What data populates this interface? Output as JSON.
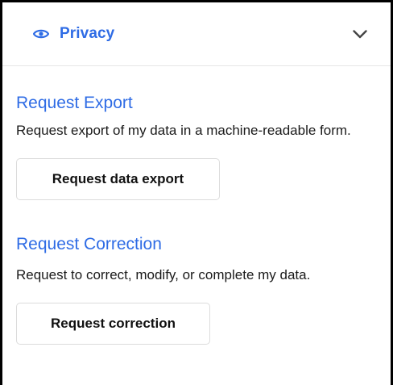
{
  "header": {
    "title": "Privacy",
    "icon": "eye-icon",
    "toggle_icon": "chevron-down-icon",
    "accent_color": "#2f6ce5"
  },
  "sections": [
    {
      "title": "Request Export",
      "description": "Request export of my data in a machine-readable form.",
      "button_label": "Request data export"
    },
    {
      "title": "Request Correction",
      "description": "Request to correct, modify, or complete my data.",
      "button_label": "Request correction"
    }
  ]
}
